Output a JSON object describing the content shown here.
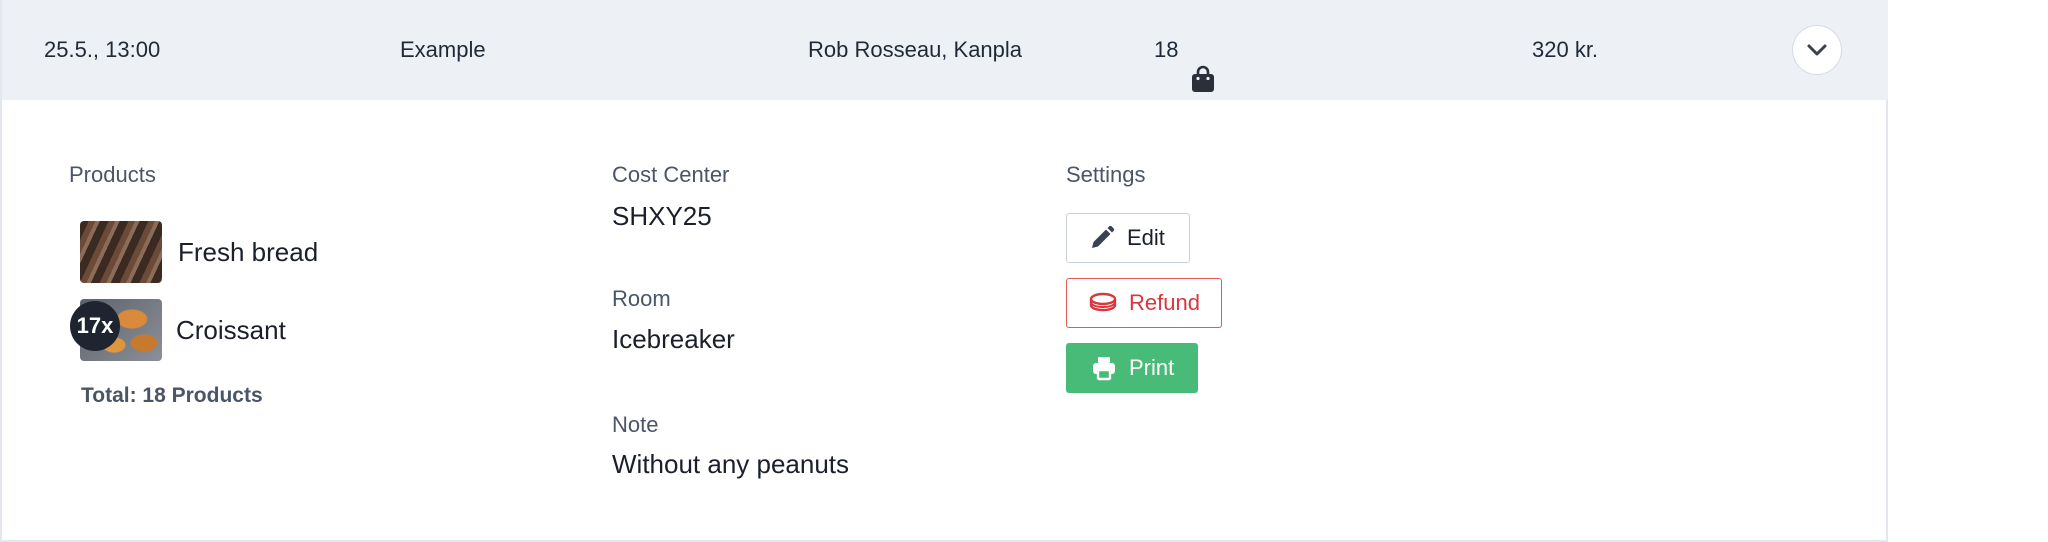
{
  "order_row": {
    "datetime": "25.5., 13:00",
    "name": "Example",
    "customer": "Rob Rosseau, Kanpla",
    "item_count": "18",
    "item_count_icon": "shopping-bag-icon",
    "price": "320 kr.",
    "expand_icon": "chevron-down-icon"
  },
  "details": {
    "products_label": "Products",
    "products": [
      {
        "name": "Fresh bread",
        "image": "bread-thumbnail",
        "quantity_badge": ""
      },
      {
        "name": "Croissant",
        "image": "croissant-thumbnail",
        "quantity_badge": "17x"
      }
    ],
    "total_label": "Total: 18 Products",
    "cost_center_label": "Cost Center",
    "cost_center_value": "SHXY25",
    "room_label": "Room",
    "room_value": "Icebreaker",
    "note_label": "Note",
    "note_value": "Without any peanuts",
    "settings_label": "Settings",
    "buttons": {
      "edit": {
        "label": "Edit",
        "icon": "pencil-icon"
      },
      "refund": {
        "label": "Refund",
        "icon": "coins-icon"
      },
      "print": {
        "label": "Print",
        "icon": "printer-icon"
      }
    }
  },
  "colors": {
    "row_background": "#edf1f5",
    "refund_red": "#d9363e",
    "print_green": "#48bb78",
    "label_gray": "#4b5568"
  }
}
